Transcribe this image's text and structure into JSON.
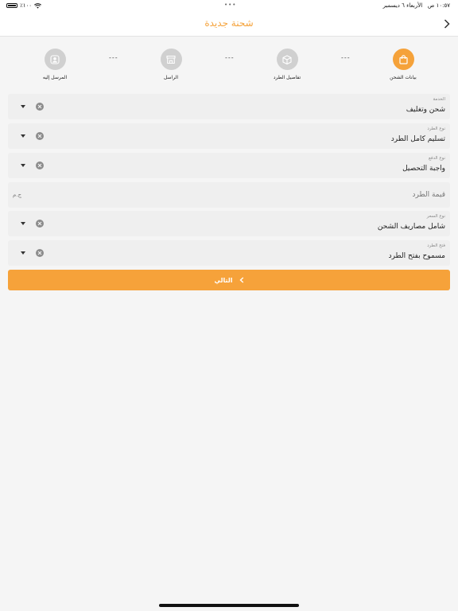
{
  "status_bar": {
    "time": "١٠:٥٧ ص",
    "date": "الأربعاء ٦ ديسمبر",
    "battery": "٪١٠٠",
    "dots": "•••"
  },
  "nav": {
    "title": "شحنة جديدة"
  },
  "steps": [
    {
      "label": "بيانات الشحن",
      "icon": "bag-icon",
      "active": true
    },
    {
      "label": "تفاصيل الطرد",
      "icon": "box-icon",
      "active": false
    },
    {
      "label": "الراسل",
      "icon": "store-icon",
      "active": false
    },
    {
      "label": "المرسل إليه",
      "icon": "user-icon",
      "active": false
    }
  ],
  "step_separator": "---",
  "fields": {
    "service": {
      "label": "الخدمة",
      "value": "شحن وتغليف"
    },
    "parcel_type": {
      "label": "نوع الطرد",
      "value": "تسليم كامل الطرد"
    },
    "payment_type": {
      "label": "نوع الدفع",
      "value": "واجبة التحصيل"
    },
    "parcel_value": {
      "placeholder": "قيمة الطرد",
      "unit": "ج.م"
    },
    "price_type": {
      "label": "نوع السعر",
      "value": "شامل مصاريف الشحن"
    },
    "parcel_open": {
      "label": "فتح الطرد",
      "value": "مسموح بفتح الطرد"
    }
  },
  "next_button": {
    "label": "التالي"
  },
  "colors": {
    "accent": "#f5a23a",
    "inactive_step": "#d0d0d0",
    "field_bg": "#efefef"
  }
}
